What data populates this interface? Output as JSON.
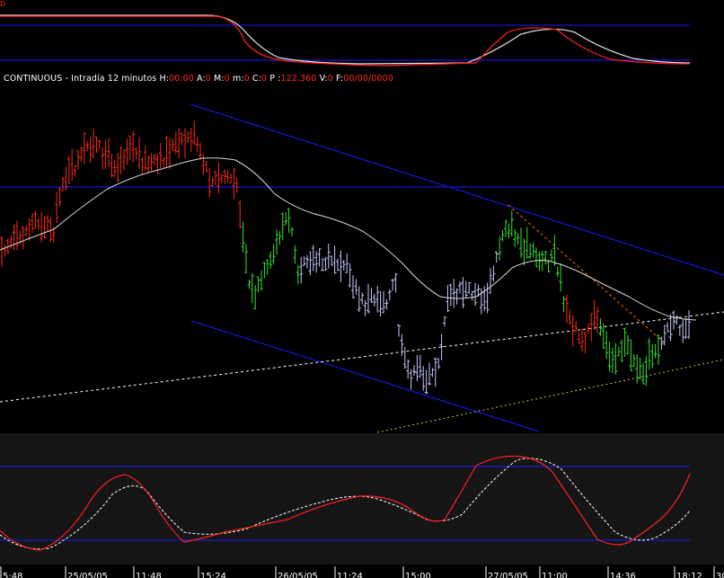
{
  "window": {
    "top_label": "D"
  },
  "info_bar": {
    "symbol": "CONTINUOUS",
    "separator": " - ",
    "period": "Intradía 12 minutos",
    "h_label": "H:",
    "h_value": "00:00",
    "a_label": "A:",
    "a_value": "0",
    "m_label": "M:",
    "m_value": "0",
    "min_label": "m:",
    "min_value": "0",
    "c_label": "C:",
    "c_value": "0",
    "p_label": "P :",
    "p_value": "122.360",
    "v_label": "V:",
    "v_value": "0",
    "f_label": "F:",
    "f_value": "00/00/0000"
  },
  "x_axis": {
    "ticks": [
      "5:48",
      "25/05/05",
      "11:48",
      "15:24",
      "26/05/05",
      "11:24",
      "15:00",
      "27/05/05",
      "11:00",
      "14:36",
      "18:12",
      "30/"
    ]
  },
  "colors": {
    "background": "#000000",
    "oscillator_background": "#161616",
    "channel_line": "#1a1aff",
    "bearish_bar": "#ff2a1a",
    "bullish_bar": "#33e62e",
    "neutral_bar": "#c8c8ff",
    "moving_average": "#d8d8d8",
    "trendline": "#ffffff",
    "dashed_lower_trend": "#c9c83a",
    "dashed_down_trend": "#ff6a00",
    "osc_fast": "#ff2020",
    "osc_slow": "#ffffff",
    "text_white": "#ffffff",
    "text_red": "#ff2a1a"
  }
}
